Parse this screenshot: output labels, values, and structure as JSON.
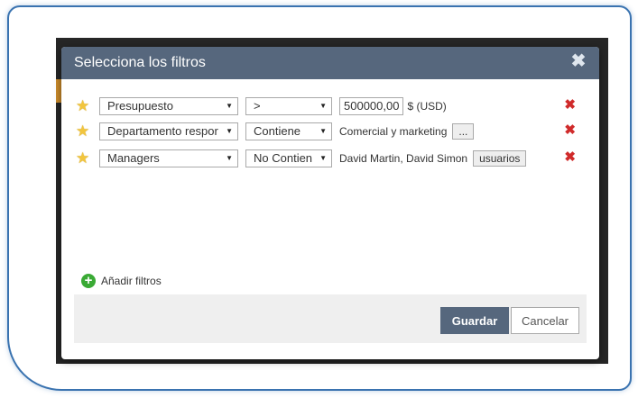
{
  "modal": {
    "title": "Selecciona los filtros",
    "close_icon": "✖"
  },
  "filters": [
    {
      "field": "Presupuesto",
      "operator": ">",
      "value": "500000,00",
      "suffix": "$ (USD)"
    },
    {
      "field": "Departamento respor",
      "operator": "Contiene",
      "value": "Comercial y marketing",
      "button": "..."
    },
    {
      "field": "Managers",
      "operator": "No Contien",
      "value": "David Martin, David Simon",
      "button": "usuarios"
    }
  ],
  "add_filters_label": "Añadir filtros",
  "footer": {
    "save_label": "Guardar",
    "cancel_label": "Cancelar"
  },
  "colors": {
    "header": "#56677d",
    "star": "#f2c53d",
    "remove": "#d02b2b",
    "add": "#3aaa35"
  }
}
